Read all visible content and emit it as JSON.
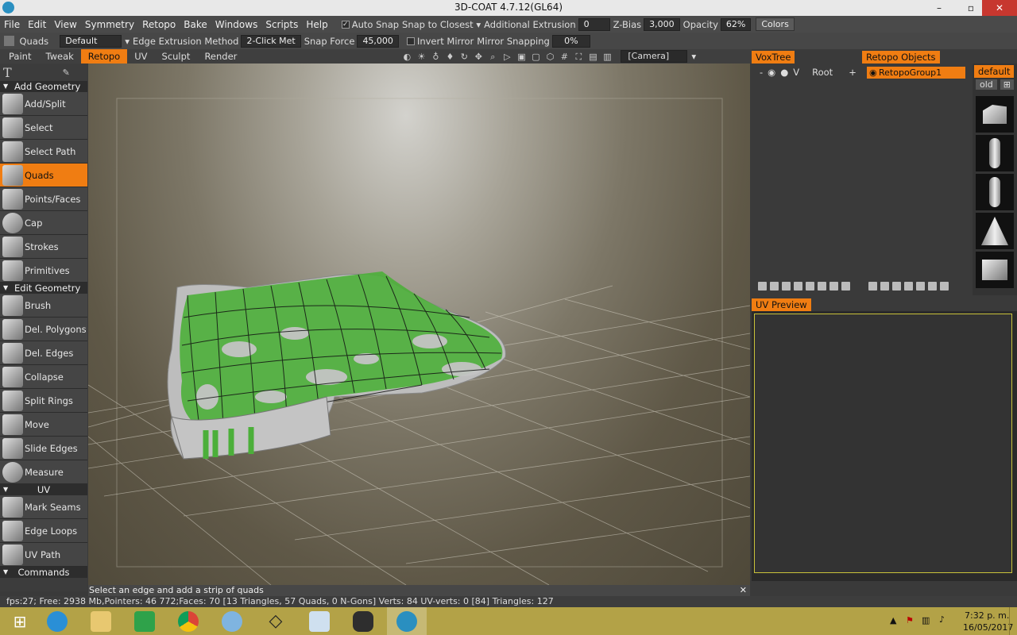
{
  "window": {
    "title": "3D-COAT 4.7.12(GL64)",
    "min": "–",
    "max": "▫",
    "close": "✕"
  },
  "menu": [
    "File",
    "Edit",
    "View",
    "Symmetry",
    "Retopo",
    "Bake",
    "Windows",
    "Scripts",
    "Help"
  ],
  "snap": {
    "auto_snap_label": "Auto Snap",
    "snap_closest": "Snap to Closest",
    "additional_extrusion_label": "Additional Extrusion",
    "additional_extrusion": "0",
    "zbias_label": "Z-Bias",
    "zbias": "3,000",
    "opacity_label": "Opacity",
    "opacity": "62%",
    "colors_label": "Colors"
  },
  "tool_options": {
    "tool_name": "Quads",
    "preset": "Default",
    "edge_extrusion_label": "Edge Extrusion Method",
    "edge_extrusion_value": "2-Click Met",
    "snap_force_label": "Snap Force",
    "snap_force": "45,000",
    "invert_mirror_label": "Invert Mirror",
    "mirror_snapping_label": "Mirror Snapping",
    "mirror_snapping": "0%"
  },
  "rooms": [
    "Paint",
    "Tweak",
    "Retopo",
    "UV",
    "Sculpt",
    "Render"
  ],
  "active_room": "Retopo",
  "camera": "[Camera]",
  "sections": {
    "add_geometry": "Add Geometry",
    "edit_geometry": "Edit Geometry",
    "uv": "UV",
    "commands": "Commands"
  },
  "tools_add": [
    "Add/Split",
    "Select",
    "Select Path",
    "Quads",
    "Points/Faces",
    "Cap",
    "Strokes",
    "Primitives"
  ],
  "tools_edit": [
    "Brush",
    "Del. Polygons",
    "Del. Edges",
    "Collapse",
    "Split Rings",
    "Move",
    "Slide Edges",
    "Measure"
  ],
  "tools_uv": [
    "Mark Seams",
    "Edge Loops",
    "UV Path"
  ],
  "active_tool": "Quads",
  "status_hint": "Select an edge and add a strip of quads",
  "info_bar": "fps:27;    Free: 2938 Mb,Pointers: 46 772;Faces: 70 [13 Triangles, 57 Quads, 0 N-Gons]  Verts: 84   UV-verts: 0 [84] Triangles: 127",
  "voxtree": {
    "tab": "VoxTree",
    "root_v": "V",
    "root_label": "Root",
    "add": "+"
  },
  "retopo_objects": {
    "tab": "Retopo  Objects",
    "group": "RetopoGroup1"
  },
  "presets": {
    "tab": "default",
    "old": "old"
  },
  "uv_preview": {
    "tab": "UV  Preview"
  },
  "taskbar": {
    "time": "7:32 p. m.",
    "date": "16/05/2017"
  },
  "colors": {
    "accent": "#f07d12",
    "mesh_green": "#4caf3a",
    "mesh_gray": "#b8b8b8"
  }
}
